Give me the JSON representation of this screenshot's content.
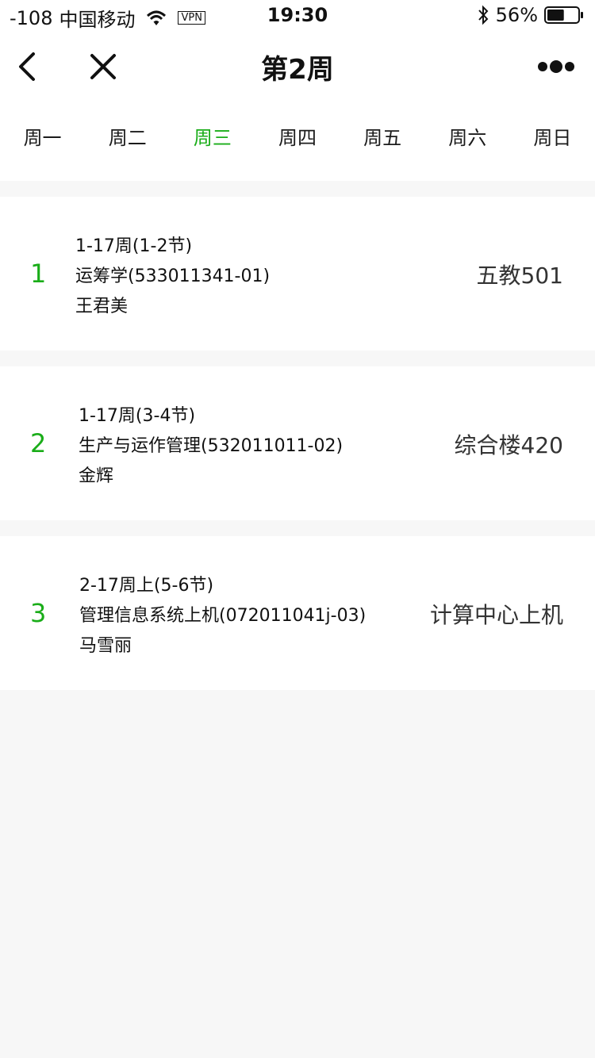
{
  "status_bar": {
    "signal": "-108",
    "carrier": "中国移动",
    "vpn": "VPN",
    "time": "19:30",
    "battery": "56%",
    "battery_level": 0.56
  },
  "nav": {
    "title": "第2周"
  },
  "tabs": [
    {
      "label": "周一"
    },
    {
      "label": "周二"
    },
    {
      "label": "周三"
    },
    {
      "label": "周四"
    },
    {
      "label": "周五"
    },
    {
      "label": "周六"
    },
    {
      "label": "周日"
    }
  ],
  "active_tab": "周三",
  "courses": [
    {
      "index": "1",
      "weeks": "1-17周(1-2节)",
      "name": "运筹学(533011341-01)",
      "teacher": "王君美",
      "room": "五教501"
    },
    {
      "index": "2",
      "weeks": "1-17周(3-4节)",
      "name": "生产与运作管理(532011011-02)",
      "teacher": "金辉",
      "room": "综合楼420"
    },
    {
      "index": "3",
      "weeks": "2-17周上(5-6节)",
      "name": "管理信息系统上机(072011041j-03)",
      "teacher": "马雪丽",
      "room": "计算中心上机"
    }
  ],
  "colors": {
    "accent": "#1aad19",
    "background": "#f7f7f7"
  }
}
